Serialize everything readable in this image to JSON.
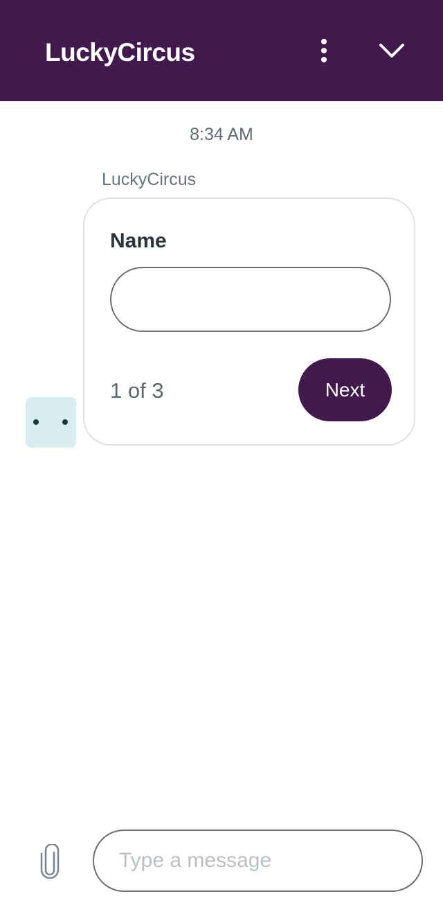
{
  "header": {
    "title": "LuckyCircus",
    "menu_icon": "more-vertical-icon",
    "collapse_icon": "chevron-down-icon",
    "background_color": "#42194d"
  },
  "conversation": {
    "timestamp": "8:34 AM",
    "sender": "LuckyCircus",
    "avatar_icon": "bot-face-icon",
    "card": {
      "field_label": "Name",
      "field_value": "",
      "pager": "1 of 3",
      "next_label": "Next"
    }
  },
  "composer": {
    "attach_icon": "paperclip-icon",
    "placeholder": "Type a message",
    "value": ""
  },
  "colors": {
    "accent": "#42194d",
    "avatar_bg": "#d7edf0"
  }
}
